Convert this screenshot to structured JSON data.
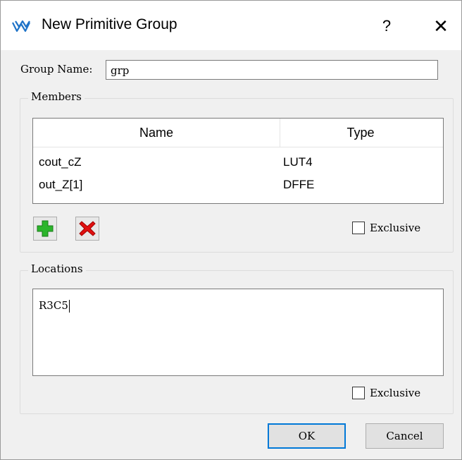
{
  "window": {
    "title": "New Primitive Group",
    "help_glyph": "?",
    "close_glyph": "✕",
    "icon": "gowin-logo-icon"
  },
  "group_name": {
    "label": "Group Name:",
    "value": "grp"
  },
  "members": {
    "legend": "Members",
    "columns": [
      "Name",
      "Type"
    ],
    "rows": [
      {
        "name": "cout_cZ",
        "type": "LUT4"
      },
      {
        "name": "out_Z[1]",
        "type": "DFFE"
      }
    ],
    "add_icon": "plus-icon",
    "remove_icon": "delete-x-icon",
    "exclusive_label": "Exclusive",
    "exclusive_checked": false
  },
  "locations": {
    "legend": "Locations",
    "value": "R3C5",
    "exclusive_label": "Exclusive",
    "exclusive_checked": false
  },
  "buttons": {
    "ok": "OK",
    "cancel": "Cancel"
  },
  "colors": {
    "accent": "#0078d7",
    "add_green": "#2bb52b",
    "remove_red": "#e01010"
  }
}
